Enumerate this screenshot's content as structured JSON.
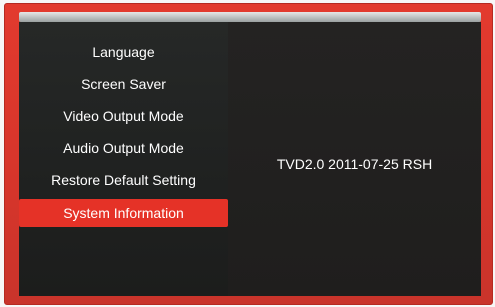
{
  "menu": {
    "items": [
      {
        "label": "Language",
        "selected": false
      },
      {
        "label": "Screen Saver",
        "selected": false
      },
      {
        "label": "Video Output Mode",
        "selected": false
      },
      {
        "label": "Audio Output Mode",
        "selected": false
      },
      {
        "label": "Restore Default Setting",
        "selected": false
      },
      {
        "label": "System Information",
        "selected": true
      }
    ]
  },
  "info": {
    "text": "TVD2.0  2011-07-25 RSH"
  },
  "colors": {
    "frame_red": "#d6352b",
    "selected_red": "#e53227",
    "panel_dark": "#1f2120",
    "text": "#ffffff"
  }
}
